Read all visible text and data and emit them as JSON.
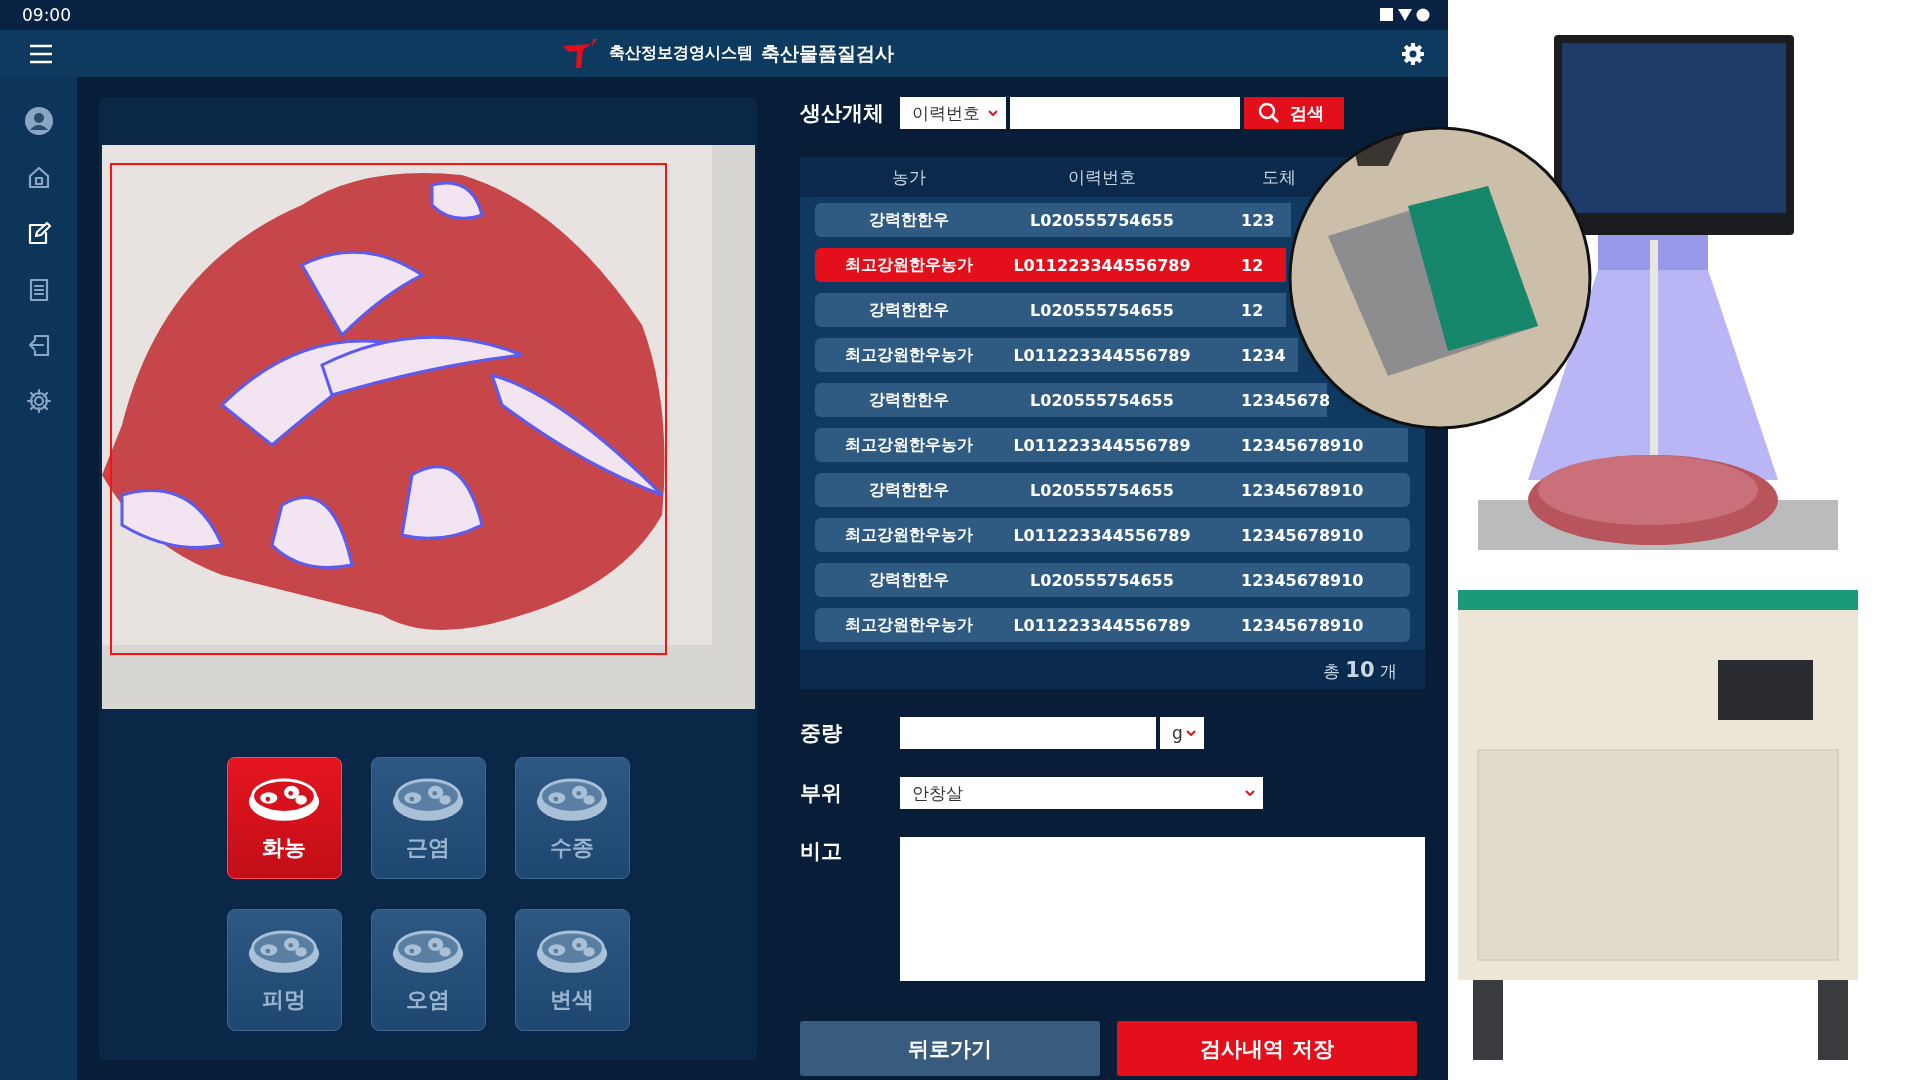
{
  "status_bar": {
    "time": "09:00"
  },
  "header": {
    "app_name": "축산정보경영시스템",
    "title": "축산물품질검사"
  },
  "sidebar": {
    "items": [
      {
        "kind": "profile",
        "selected": false
      },
      {
        "kind": "home",
        "selected": false
      },
      {
        "kind": "edit",
        "selected": true
      },
      {
        "kind": "list",
        "selected": false
      },
      {
        "kind": "logout",
        "selected": false
      },
      {
        "kind": "settings",
        "selected": false
      }
    ]
  },
  "categories": [
    {
      "label": "화농",
      "selected": true
    },
    {
      "label": "근염",
      "selected": false
    },
    {
      "label": "수종",
      "selected": false
    },
    {
      "label": "피멍",
      "selected": false
    },
    {
      "label": "오염",
      "selected": false
    },
    {
      "label": "변색",
      "selected": false
    }
  ],
  "search": {
    "label": "생산개체",
    "filter": "이력번호",
    "button": "검색"
  },
  "table": {
    "columns": [
      "농가",
      "이력번호",
      "도체"
    ],
    "rows": [
      {
        "cells": [
          "강력한한우",
          "L020555754655",
          "123"
        ],
        "selected": false
      },
      {
        "cells": [
          "최고강원한우농가",
          "L011223344556789",
          "12"
        ],
        "selected": true
      },
      {
        "cells": [
          "강력한한우",
          "L020555754655",
          "12"
        ],
        "selected": false
      },
      {
        "cells": [
          "최고강원한우농가",
          "L011223344556789",
          "1234"
        ],
        "selected": false
      },
      {
        "cells": [
          "강력한한우",
          "L020555754655",
          "12345678"
        ],
        "selected": false
      },
      {
        "cells": [
          "최고강원한우농가",
          "L011223344556789",
          "12345678910"
        ],
        "selected": false
      },
      {
        "cells": [
          "강력한한우",
          "L020555754655",
          "12345678910"
        ],
        "selected": false
      },
      {
        "cells": [
          "최고강원한우농가",
          "L011223344556789",
          "12345678910"
        ],
        "selected": false
      },
      {
        "cells": [
          "강력한한우",
          "L020555754655",
          "12345678910"
        ],
        "selected": false
      },
      {
        "cells": [
          "최고강원한우농가",
          "L011223344556789",
          "12345678910"
        ],
        "selected": false
      }
    ],
    "total": "총 **10** 개"
  },
  "form": {
    "weight": {
      "label": "중량",
      "unit": "g"
    },
    "part": {
      "label": "부위",
      "value": "안창살"
    },
    "note": {
      "label": "비고"
    }
  },
  "buttons": {
    "back": "뒤로가기",
    "save": "검사내역 저장"
  }
}
